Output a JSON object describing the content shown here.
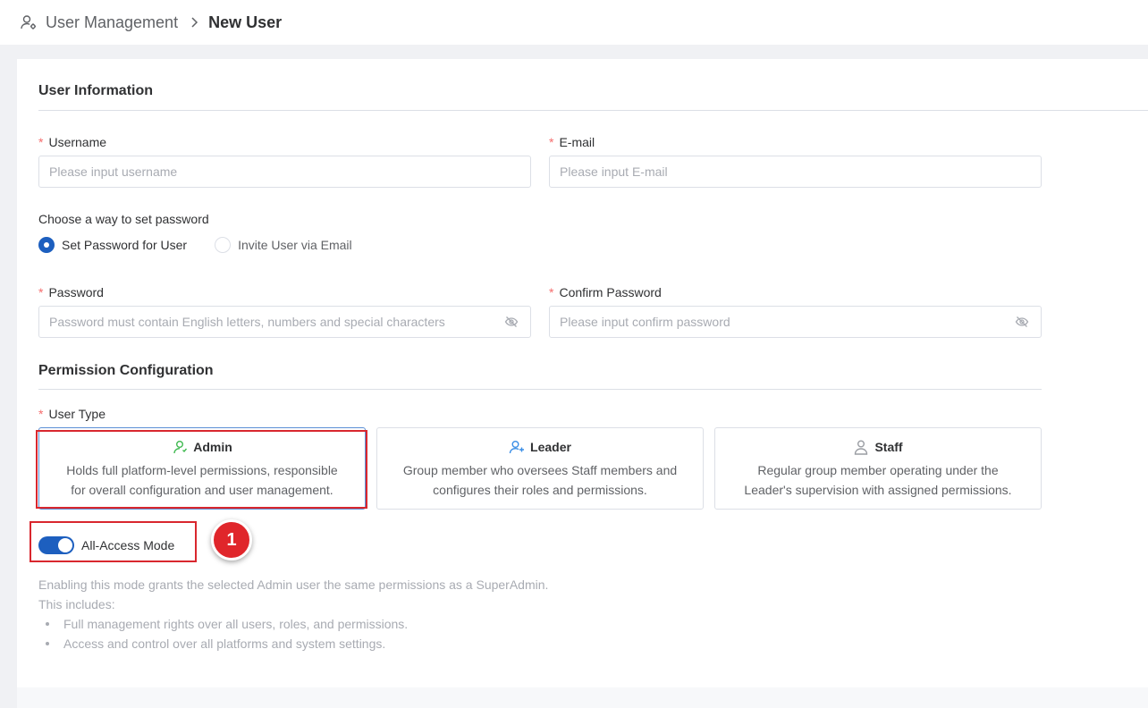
{
  "breadcrumb": {
    "parent": "User Management",
    "current": "New User",
    "icon": "user-gear-icon",
    "separator_icon": "chevron-right-icon"
  },
  "user_info": {
    "title": "User Information",
    "username": {
      "label": "Username",
      "placeholder": "Please input username",
      "value": ""
    },
    "email": {
      "label": "E-mail",
      "placeholder": "Please input E-mail",
      "value": ""
    },
    "password_method": {
      "label": "Choose a way to set password",
      "options": [
        {
          "label": "Set Password for User",
          "selected": true
        },
        {
          "label": "Invite User via Email",
          "selected": false
        }
      ]
    },
    "password": {
      "label": "Password",
      "placeholder": "Password must contain English letters, numbers and special characters",
      "value": "",
      "icon": "eye-off-icon"
    },
    "confirm_password": {
      "label": "Confirm Password",
      "placeholder": "Please input confirm password",
      "value": "",
      "icon": "eye-off-icon"
    }
  },
  "permission": {
    "title": "Permission Configuration",
    "user_type_label": "User Type",
    "types": [
      {
        "name": "Admin",
        "icon": "user-icon",
        "desc1": "Holds full platform-level permissions, responsible",
        "desc2": "for overall configuration and user management.",
        "selected": true
      },
      {
        "name": "Leader",
        "icon": "user-add-icon",
        "desc1": "Group member who oversees Staff members and",
        "desc2": "configures their roles and permissions.",
        "selected": false
      },
      {
        "name": "Staff",
        "icon": "person-icon",
        "desc1": "Regular group member operating under the",
        "desc2": "Leader's supervision with assigned permissions.",
        "selected": false
      }
    ],
    "all_access": {
      "label": "All-Access Mode",
      "enabled": true,
      "desc_line1": "Enabling this mode grants the selected Admin user the same permissions as a SuperAdmin.",
      "desc_line2": "This includes:",
      "bullets": [
        "Full management rights over all users, roles, and permissions.",
        "Access and control over all platforms and system settings."
      ]
    }
  },
  "annotation": {
    "step": "1"
  },
  "colors": {
    "primary": "#1d5fbf",
    "required": "#f56c6c",
    "highlight": "#d9272e",
    "admin_icon": "#3fb950",
    "leader_icon": "#3a8ee6",
    "staff_icon": "#9a9da3"
  }
}
